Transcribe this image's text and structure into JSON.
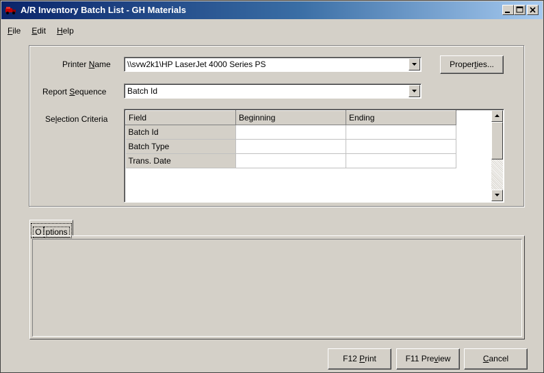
{
  "window": {
    "title": "A/R Inventory Batch List - GH Materials"
  },
  "menu": {
    "items": [
      {
        "label": "File",
        "mnemonic": "F",
        "rest": "ile"
      },
      {
        "label": "Edit",
        "mnemonic": "E",
        "rest": "dit"
      },
      {
        "label": "Help",
        "mnemonic": "H",
        "rest": "elp"
      }
    ]
  },
  "form": {
    "printer_label_pre": "Printer ",
    "printer_label_u": "N",
    "printer_label_post": "ame",
    "printer_value": "\\\\svw2k1\\HP LaserJet 4000 Series PS",
    "properties_pre": "Proper",
    "properties_u": "t",
    "properties_post": "ies...",
    "sequence_label_pre": "Report ",
    "sequence_label_u": "S",
    "sequence_label_post": "equence",
    "sequence_value": "Batch Id",
    "criteria_label_pre": "Se",
    "criteria_label_u": "l",
    "criteria_label_post": "ection Criteria"
  },
  "criteria_table": {
    "headers": [
      "Field",
      "Beginning",
      "Ending"
    ],
    "rows": [
      {
        "field": "Batch Id",
        "beginning": "",
        "ending": ""
      },
      {
        "field": "Batch Type",
        "beginning": "",
        "ending": ""
      },
      {
        "field": "Trans. Date",
        "beginning": "",
        "ending": ""
      }
    ]
  },
  "tabs": {
    "options_u": "O",
    "options_rest": "ptions"
  },
  "buttons": {
    "print_key": "F12",
    "print_u": "P",
    "print_rest": "rint",
    "preview_key": "F11",
    "preview_pre": "Pre",
    "preview_u": "v",
    "preview_rest": "iew",
    "cancel_u": "C",
    "cancel_rest": "ancel"
  },
  "colors": {
    "titlebar_start": "#0a246a",
    "titlebar_end": "#a6caf0",
    "face": "#d4d0c8"
  }
}
